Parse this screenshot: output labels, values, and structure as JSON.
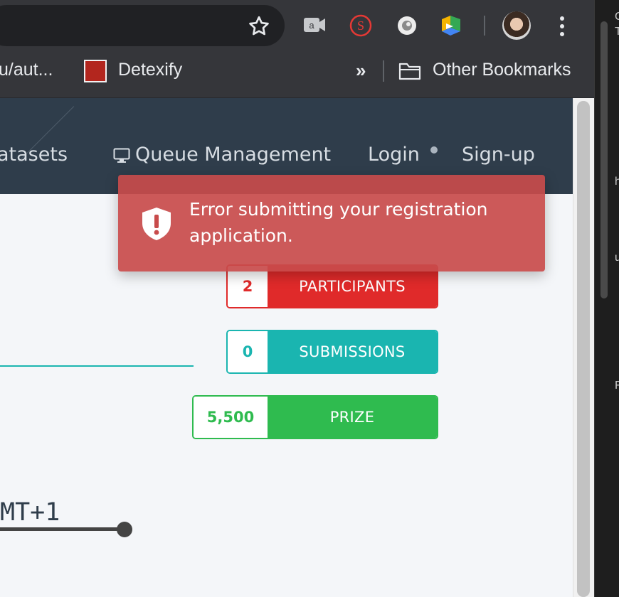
{
  "browser": {
    "omnibox_text": "",
    "bookmarks": {
      "items": [
        {
          "label": "u/aut..."
        },
        {
          "label": "Detexify"
        }
      ],
      "overflow_label": "»",
      "other_bookmarks_label": "Other Bookmarks"
    },
    "extensions": [
      "a",
      "S",
      "",
      ""
    ]
  },
  "side_strip": {
    "chars": [
      "C",
      "T",
      "h",
      "u",
      "F"
    ]
  },
  "navbar": {
    "items": [
      {
        "label": "atasets"
      },
      {
        "label": "Queue Management"
      },
      {
        "label": "Login"
      },
      {
        "label": "Sign-up"
      }
    ]
  },
  "main": {
    "timezone_text": "MT+1",
    "stats": [
      {
        "value": "2",
        "label": "PARTICIPANTS",
        "color": "#e02a2a"
      },
      {
        "value": "0",
        "label": "SUBMISSIONS",
        "color": "#1ab5b0"
      },
      {
        "value": "5,500",
        "label": "PRIZE",
        "color": "#2fbb4f"
      }
    ]
  },
  "toast": {
    "message": "Error submitting your registration application.",
    "color": "#c84b4b"
  }
}
